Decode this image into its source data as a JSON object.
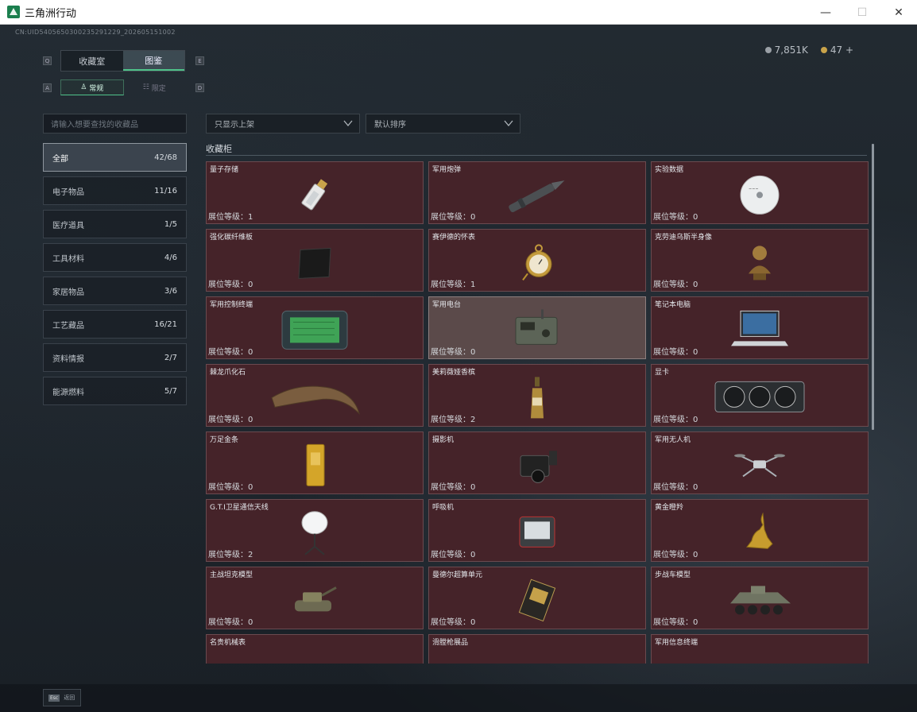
{
  "window": {
    "title": "三角洲行动",
    "minimize": "—",
    "maximize": "☐",
    "close": "✕"
  },
  "uid": "CN:UID5405650300235291229_202605151002",
  "currency": {
    "silver": "7,851K",
    "gold": "47 +"
  },
  "key_hints": {
    "q": "Q",
    "e": "E",
    "a": "A",
    "d": "D"
  },
  "tabs": [
    {
      "label": "收藏室"
    },
    {
      "label": "图鉴"
    }
  ],
  "subtabs": [
    {
      "label": "常规"
    },
    {
      "label": "限定"
    }
  ],
  "search": {
    "placeholder": "请输入想要查找的收藏品"
  },
  "categories": [
    {
      "label": "全部",
      "count": "42/68"
    },
    {
      "label": "电子物品",
      "count": "11/16"
    },
    {
      "label": "医疗道具",
      "count": "1/5"
    },
    {
      "label": "工具材料",
      "count": "4/6"
    },
    {
      "label": "家居物品",
      "count": "3/6"
    },
    {
      "label": "工艺藏品",
      "count": "16/21"
    },
    {
      "label": "资料情报",
      "count": "2/7"
    },
    {
      "label": "能源燃料",
      "count": "5/7"
    }
  ],
  "filters": {
    "show": "只显示上架",
    "sort": "默认排序"
  },
  "section_title": "收藏柜",
  "level_prefix": "展位等级：",
  "items": [
    {
      "name": "量子存储",
      "level": "1",
      "icon": "usb-drive"
    },
    {
      "name": "军用炮弹",
      "level": "0",
      "icon": "shell"
    },
    {
      "name": "实验数据",
      "level": "0",
      "icon": "disc"
    },
    {
      "name": "强化碳纤维板",
      "level": "0",
      "icon": "carbon-plate"
    },
    {
      "name": "赛伊德的怀表",
      "level": "1",
      "icon": "pocket-watch"
    },
    {
      "name": "克劳迪乌斯半身像",
      "level": "0",
      "icon": "bust"
    },
    {
      "name": "军用控制终端",
      "level": "0",
      "icon": "control-terminal"
    },
    {
      "name": "军用电台",
      "level": "0",
      "icon": "radio"
    },
    {
      "name": "笔记本电脑",
      "level": "0",
      "icon": "laptop"
    },
    {
      "name": "棘龙爪化石",
      "level": "0",
      "icon": "claw-fossil"
    },
    {
      "name": "美莉薇娅香槟",
      "level": "2",
      "icon": "champagne"
    },
    {
      "name": "显卡",
      "level": "0",
      "icon": "gpu"
    },
    {
      "name": "万足金条",
      "level": "0",
      "icon": "gold-bar"
    },
    {
      "name": "摄影机",
      "level": "0",
      "icon": "camera"
    },
    {
      "name": "军用无人机",
      "level": "0",
      "icon": "drone"
    },
    {
      "name": "G.T.I卫星通信天线",
      "level": "2",
      "icon": "satellite-dish"
    },
    {
      "name": "呼吸机",
      "level": "0",
      "icon": "ventilator"
    },
    {
      "name": "黄金瞪羚",
      "level": "0",
      "icon": "gold-gazelle"
    },
    {
      "name": "主战坦克模型",
      "level": "0",
      "icon": "tank-model"
    },
    {
      "name": "曼德尔超算单元",
      "level": "0",
      "icon": "compute-unit"
    },
    {
      "name": "步战车模型",
      "level": "0",
      "icon": "ifv-model"
    },
    {
      "name": "名贵机械表",
      "level": "",
      "icon": "watch"
    },
    {
      "name": "滑膛枪展品",
      "level": "",
      "icon": "musket"
    },
    {
      "name": "军用信息终端",
      "level": "",
      "icon": "info-terminal"
    }
  ],
  "footer": {
    "esc_key": "Esc",
    "back": "返回"
  },
  "colors": {
    "accent": "#4fc38a",
    "card_bg": "#452329",
    "card_hover": "#5b4a4a"
  }
}
